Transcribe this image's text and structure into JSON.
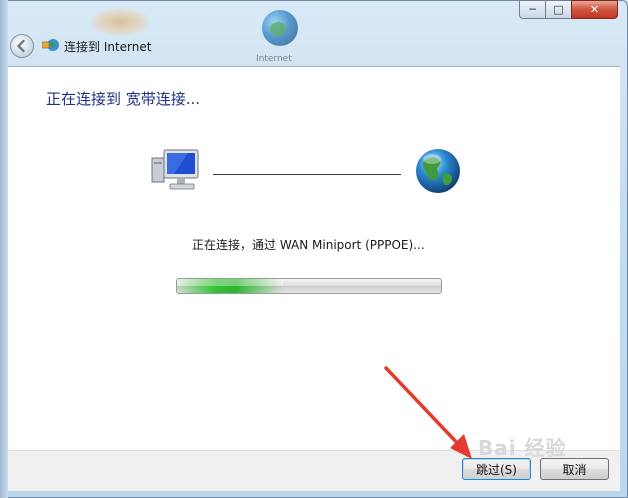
{
  "window": {
    "title": "连接到 Internet",
    "controls": {
      "minimize": "─",
      "maximize": "□",
      "close": "✕"
    },
    "back_icon": "back-arrow-icon"
  },
  "background": {
    "globe_label": "Internet"
  },
  "main": {
    "heading": "正在连接到 宽带连接...",
    "status": "正在连接，通过 WAN Miniport (PPPOE)...",
    "progress_fraction": 0.4
  },
  "footer": {
    "skip_label": "跳过(S)",
    "cancel_label": "取消"
  },
  "watermark": "Bai 经验",
  "colors": {
    "heading": "#1e3287",
    "progress_green": "#37c337",
    "annotation_arrow": "#e53b2f"
  }
}
